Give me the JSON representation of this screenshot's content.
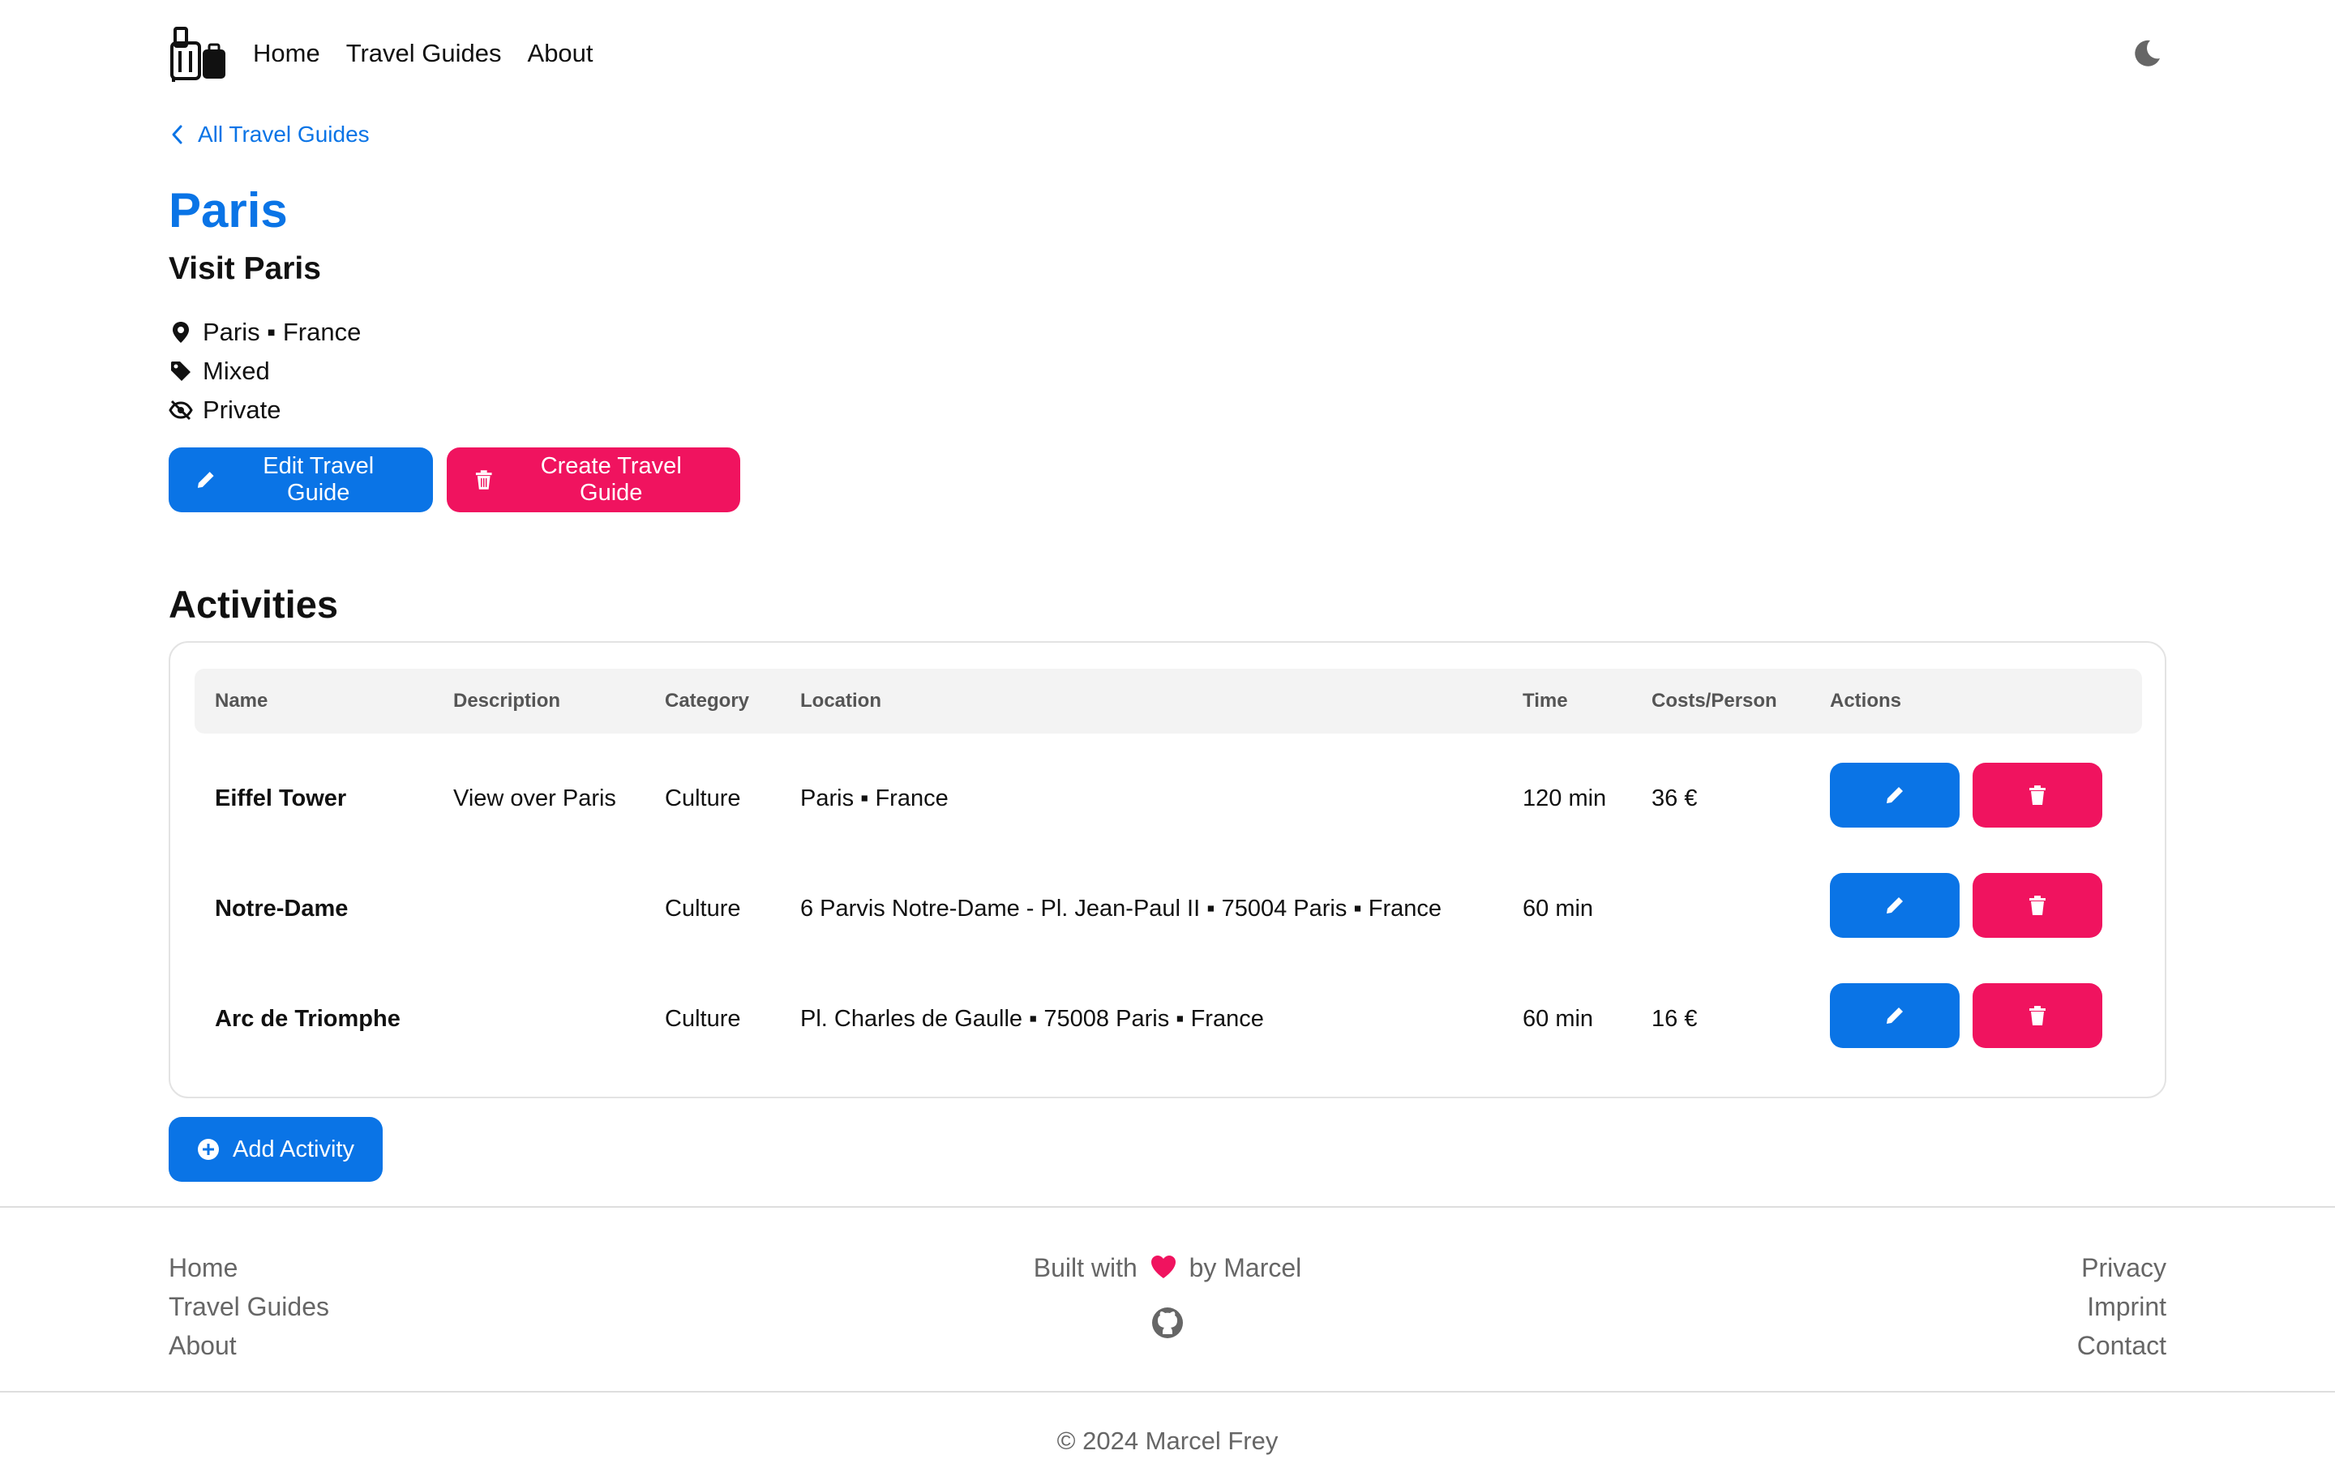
{
  "nav": {
    "links": [
      "Home",
      "Travel Guides",
      "About"
    ]
  },
  "back_link": "All Travel Guides",
  "guide": {
    "title": "Paris",
    "subtitle": "Visit Paris",
    "location": "Paris ▪ France",
    "category": "Mixed",
    "visibility": "Private"
  },
  "buttons": {
    "edit": "Edit Travel Guide",
    "create": "Create Travel Guide",
    "add_activity": "Add Activity"
  },
  "activities": {
    "title": "Activities",
    "columns": [
      "Name",
      "Description",
      "Category",
      "Location",
      "Time",
      "Costs/Person",
      "Actions"
    ],
    "rows": [
      {
        "name": "Eiffel Tower",
        "description": "View over Paris",
        "category": "Culture",
        "location": "Paris ▪ France",
        "time": "120 min",
        "cost": "36 €"
      },
      {
        "name": "Notre-Dame",
        "description": "",
        "category": "Culture",
        "location": "6 Parvis Notre-Dame - Pl. Jean-Paul II ▪ 75004 Paris ▪ France",
        "time": "60 min",
        "cost": ""
      },
      {
        "name": "Arc de Triomphe",
        "description": "",
        "category": "Culture",
        "location": "Pl. Charles de Gaulle ▪ 75008 Paris ▪ France",
        "time": "60 min",
        "cost": "16 €"
      }
    ]
  },
  "footer": {
    "left_links": [
      "Home",
      "Travel Guides",
      "About"
    ],
    "built_prefix": "Built with",
    "built_suffix": "by Marcel",
    "right_links": [
      "Privacy",
      "Imprint",
      "Contact"
    ],
    "copyright": "© 2024 Marcel Frey"
  },
  "colors": {
    "primary": "#0a74e6",
    "danger": "#f0135f",
    "heart": "#f0135f"
  },
  "icons": [
    "luggage-icon",
    "moon-icon",
    "chevron-left-icon",
    "map-pin-icon",
    "tag-icon",
    "eye-slash-icon",
    "pencil-icon",
    "trash-icon",
    "plus-circle-icon",
    "heart-icon",
    "github-icon"
  ]
}
